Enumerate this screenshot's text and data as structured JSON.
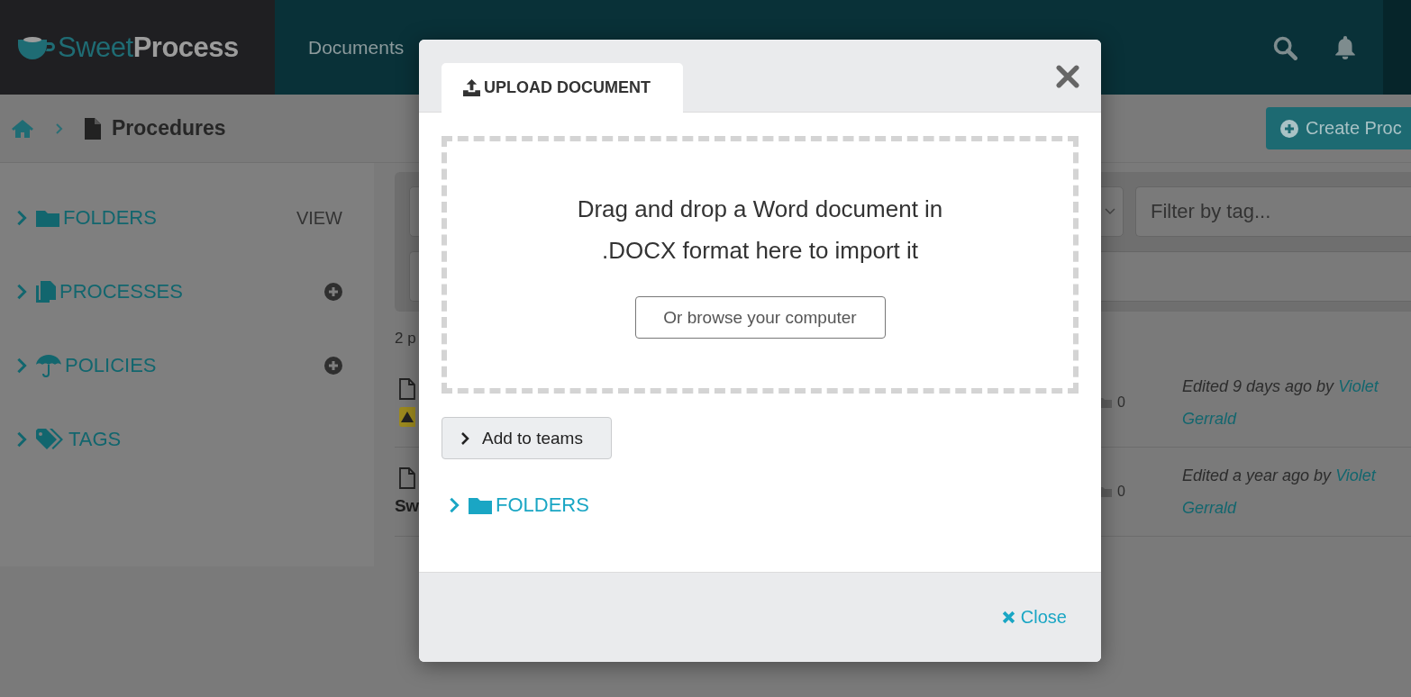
{
  "nav": {
    "logo": {
      "first": "Sweet",
      "second": "Process"
    },
    "item": "Documents"
  },
  "breadcrumb": {
    "current": "Procedures"
  },
  "create_button": "Create Proc",
  "sidebar": {
    "sections": [
      {
        "label": "FOLDERS",
        "action": {
          "kind": "text",
          "label": "VIEW"
        }
      },
      {
        "label": "PROCESSES",
        "action": {
          "kind": "add"
        }
      },
      {
        "label": "POLICIES",
        "action": {
          "kind": "add"
        }
      },
      {
        "label": "TAGS"
      }
    ]
  },
  "filters": {
    "tag_placeholder": "Filter by tag..."
  },
  "count_text": "2 p",
  "rows": [
    {
      "warning": true,
      "folders": "0",
      "edited": "Edited 9 days ago by",
      "author_line1": "Violet",
      "author_line2": "Gerrald"
    },
    {
      "warning": false,
      "title": "Sw",
      "folders": "0",
      "edited": "Edited a year ago by",
      "author_line1": "Violet",
      "author_line2": "Gerrald"
    }
  ],
  "modal": {
    "tab": {
      "label": "UPLOAD DOCUMENT",
      "selected": true
    },
    "dropzone": {
      "lines": [
        "Drag and drop a Word document in",
        ".DOCX format here to import it"
      ],
      "browse_button": "Or browse your computer"
    },
    "teams_button": "Add to teams",
    "folders": "FOLDERS",
    "close": "Close"
  }
}
